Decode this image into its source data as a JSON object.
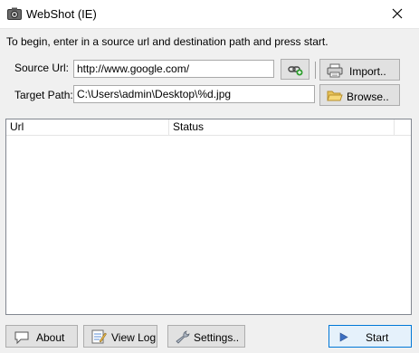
{
  "window": {
    "title": "WebShot (IE)",
    "close_icon": "close-icon",
    "app_icon": "camera-icon"
  },
  "instruction": "To begin, enter in a source url and destination path and press start.",
  "source": {
    "label": "Source Url:",
    "value": "http://www.google.com/",
    "add_button_icon": "add-link-icon",
    "import_label": "Import..",
    "import_icon": "printer-icon"
  },
  "target": {
    "label": "Target Path:",
    "value": "C:\\Users\\admin\\Desktop\\%d.jpg",
    "browse_label": "Browse..",
    "browse_icon": "folder-open-icon"
  },
  "table": {
    "columns": [
      "Url",
      "Status"
    ],
    "rows": []
  },
  "footer": {
    "about_label": "About",
    "about_icon": "speech-bubble-icon",
    "viewlog_label": "View Log",
    "viewlog_icon": "notepad-icon",
    "settings_label": "Settings..",
    "settings_icon": "wrench-icon",
    "start_label": "Start",
    "start_icon": "play-icon"
  },
  "colors": {
    "accent": "#0078d7",
    "window_bg": "#f0f0f0"
  }
}
